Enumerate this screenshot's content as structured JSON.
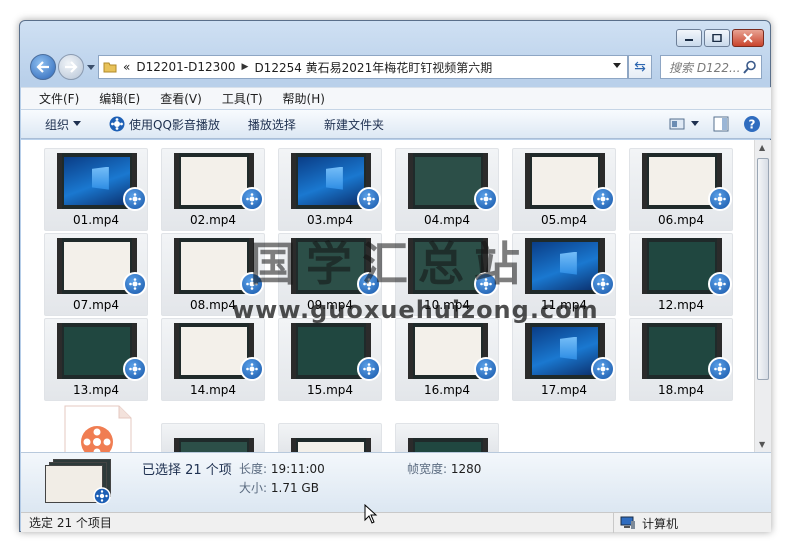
{
  "window": {
    "minimize_icon": "minimize-icon",
    "maximize_icon": "maximize-icon",
    "close_icon": "close-icon"
  },
  "address": {
    "overflow": "«",
    "crumbs": [
      "D12201-D12300",
      "D12254 黄石易2021年梅花盯钉视频第六期"
    ],
    "search_placeholder": "搜索 D122..."
  },
  "menu": [
    "文件(F)",
    "编辑(E)",
    "查看(V)",
    "工具(T)",
    "帮助(H)"
  ],
  "toolbar": {
    "organize": "组织",
    "play_qq": "使用QQ影音播放",
    "play_selection": "播放选择",
    "new_folder": "新建文件夹"
  },
  "files": [
    {
      "name": "01.mp4",
      "style": "win"
    },
    {
      "name": "02.mp4",
      "style": "slide-w"
    },
    {
      "name": "03.mp4",
      "style": "win"
    },
    {
      "name": "04.mp4",
      "style": "slide-g"
    },
    {
      "name": "05.mp4",
      "style": "slide-w"
    },
    {
      "name": "06.mp4",
      "style": "slide-w"
    },
    {
      "name": "07.mp4",
      "style": "slide-w"
    },
    {
      "name": "08.mp4",
      "style": "slide-w"
    },
    {
      "name": "09.mp4",
      "style": "slide-g"
    },
    {
      "name": "10.mp4",
      "style": "slide-g"
    },
    {
      "name": "11.mp4",
      "style": "win"
    },
    {
      "name": "12.mp4",
      "style": "slide-d"
    },
    {
      "name": "13.mp4",
      "style": "slide-d"
    },
    {
      "name": "14.mp4",
      "style": "slide-w"
    },
    {
      "name": "15.mp4",
      "style": "slide-d"
    },
    {
      "name": "16.mp4",
      "style": "slide-w"
    },
    {
      "name": "17.mp4",
      "style": "win"
    },
    {
      "name": "18.mp4",
      "style": "slide-d"
    }
  ],
  "watermark": {
    "cn": "国学汇总站",
    "url": "www.guoxuehuizong.com"
  },
  "details": {
    "selected": "已选择 21 个项",
    "length_label": "长度:",
    "length_value": "19:11:00",
    "frame_width_label": "帧宽度:",
    "frame_width_value": "1280",
    "size_label": "大小:",
    "size_value": "1.71 GB"
  },
  "status": {
    "left": "选定 21 个项目",
    "computer": "计算机"
  }
}
